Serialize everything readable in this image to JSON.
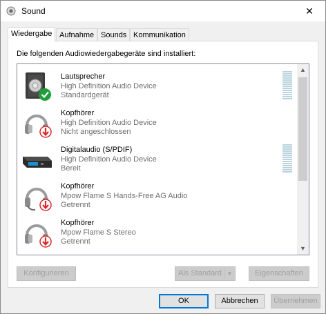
{
  "window": {
    "title": "Sound"
  },
  "tabs": [
    {
      "label": "Wiedergabe",
      "active": true
    },
    {
      "label": "Aufnahme",
      "active": false
    },
    {
      "label": "Sounds",
      "active": false
    },
    {
      "label": "Kommunikation",
      "active": false
    }
  ],
  "panel": {
    "instruction": "Die folgenden Audiowiedergabegeräte sind installiert:"
  },
  "devices": [
    {
      "name": "Lautsprecher",
      "description": "High Definition Audio Device",
      "status": "Standardgerät",
      "icon": "speaker-icon",
      "badge": "default-check-icon"
    },
    {
      "name": "Kopfhörer",
      "description": "High Definition Audio Device",
      "status": "Nicht angeschlossen",
      "icon": "headphones-icon",
      "badge": "unplugged-arrow-icon"
    },
    {
      "name": "Digitalaudio (S/PDIF)",
      "description": "High Definition Audio Device",
      "status": "Bereit",
      "icon": "digital-audio-icon",
      "badge": ""
    },
    {
      "name": "Kopfhörer",
      "description": "Mpow Flame S Hands-Free AG Audio",
      "status": "Getrennt",
      "icon": "headset-icon",
      "badge": "disconnected-arrow-icon"
    },
    {
      "name": "Kopfhörer",
      "description": "Mpow Flame S Stereo",
      "status": "Getrennt",
      "icon": "headphones-icon",
      "badge": "disconnected-arrow-icon"
    }
  ],
  "buttons": {
    "configure": "Konfigurieren",
    "set_default": "Als Standard",
    "properties": "Eigenschaften",
    "ok": "OK",
    "cancel": "Abbrechen",
    "apply": "Übernehmen"
  },
  "colors": {
    "accent": "#0078d7",
    "check_green": "#1e9e3a",
    "unplug_red": "#d92626"
  }
}
